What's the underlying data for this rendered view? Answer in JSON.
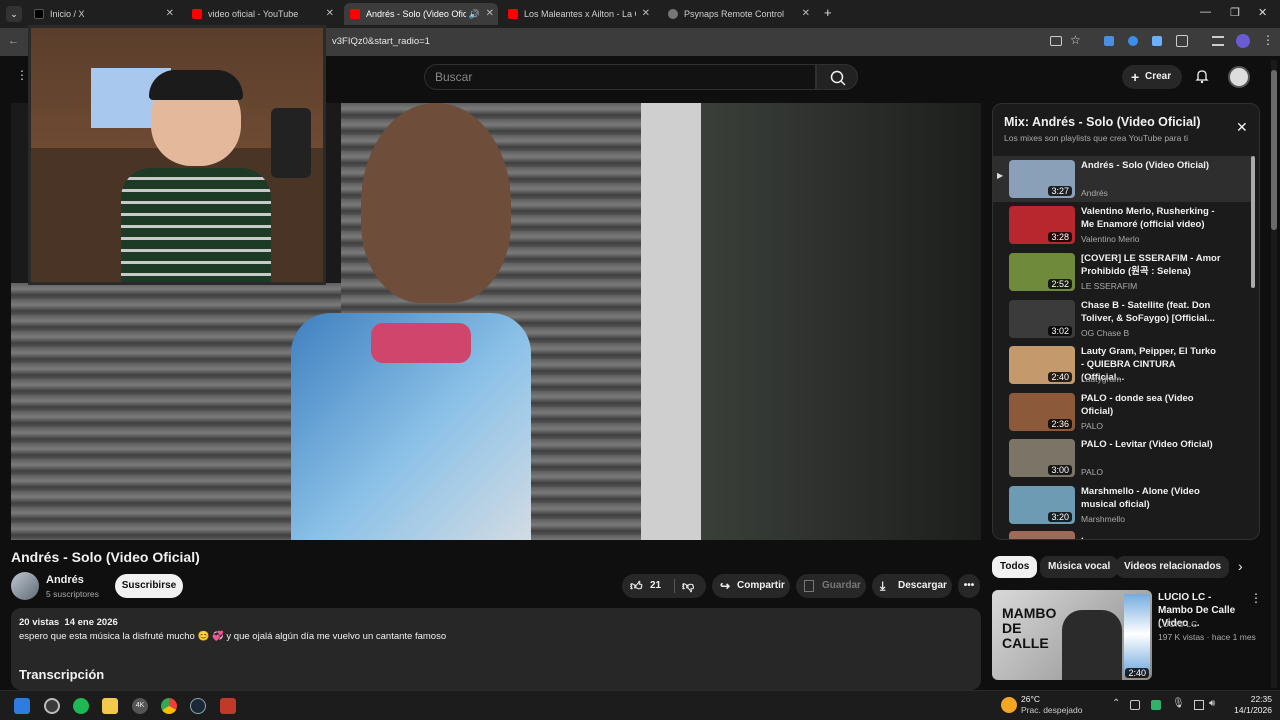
{
  "browser": {
    "tabs": [
      {
        "label": "Inicio / X",
        "color": "#000000"
      },
      {
        "label": "video oficial - YouTube",
        "color": "#ff0000"
      },
      {
        "label": "Andrés - Solo (Video Oficial)",
        "color": "#ff0000",
        "active": true
      },
      {
        "label": "Los Maleantes x Ailton - La Gorda",
        "color": "#ff0000"
      },
      {
        "label": "Psynaps Remote Control",
        "color": "#888888"
      }
    ],
    "url": "v3FIQz0&start_radio=1"
  },
  "header": {
    "search_placeholder": "Buscar",
    "create_label": "Crear"
  },
  "playlist": {
    "title": "Mix: Andrés - Solo (Video Oficial)",
    "subtitle": "Los mixes son playlists que crea YouTube para ti",
    "items": [
      {
        "title": "Andrés - Solo (Video Oficial)",
        "channel": "Andrés",
        "duration": "3:27",
        "thumb": "#8aa0b8"
      },
      {
        "title": "Valentino Merlo, Rusherking - Me Enamoré (official video)",
        "channel": "Valentino Merlo",
        "duration": "3:28",
        "thumb": "#b8262e"
      },
      {
        "title": "[COVER] LE SSERAFIM - Amor Prohibido (원곡 : Selena)",
        "channel": "LE SSERAFIM",
        "duration": "2:52",
        "thumb": "#6f8a3a"
      },
      {
        "title": "Chase B - Satellite (feat. Don Toliver, & SoFaygo) [Official...",
        "channel": "OG Chase B",
        "duration": "3:02",
        "thumb": "#3b3b3b"
      },
      {
        "title": "Lauty Gram, Peipper, El Turko - QUIEBRA CINTURA (Official...",
        "channel": "Lautygram",
        "duration": "2:40",
        "thumb": "#c49a6c"
      },
      {
        "title": "PALO - donde sea (Video Oficial)",
        "channel": "PALO",
        "duration": "2:36",
        "thumb": "#8c5a3a"
      },
      {
        "title": "PALO - Levitar (Video Oficial)",
        "channel": "PALO",
        "duration": "3:00",
        "thumb": "#7d7468"
      },
      {
        "title": "Marshmello - Alone (Video musical oficial)",
        "channel": "Marshmello",
        "duration": "3:20",
        "thumb": "#6d9bb3"
      },
      {
        "title": ".",
        "channel": "",
        "duration": "",
        "thumb": "#a06a5a"
      }
    ]
  },
  "chips": [
    "Todos",
    "Música vocal",
    "Videos relacionados"
  ],
  "video": {
    "title": "Andrés - Solo (Video Oficial)",
    "channel": "Andrés",
    "subscribers": "5 suscriptores",
    "subscribe_label": "Suscribirse",
    "likes": "21",
    "share_label": "Compartir",
    "save_label": "Guardar",
    "download_label": "Descargar",
    "views_date": "20 vistas  14 ene 2026",
    "description": "espero que esta música la disfruté mucho 😊 💞 y que ojalá algún día me vuelvo un cantante famoso",
    "transcript_heading": "Transcripción"
  },
  "recommended": {
    "title": "LUCIO LC - Mambo De Calle (Video ...",
    "channel": "LUCIO LC",
    "meta": "197 K vistas · hace 1 mes",
    "duration": "2:40",
    "thumb_text": "MAMBO DE CALLE"
  },
  "taskbar": {
    "temp": "26°C",
    "weather": "Prac. despejado",
    "time": "22:35",
    "date": "14/1/2026"
  }
}
